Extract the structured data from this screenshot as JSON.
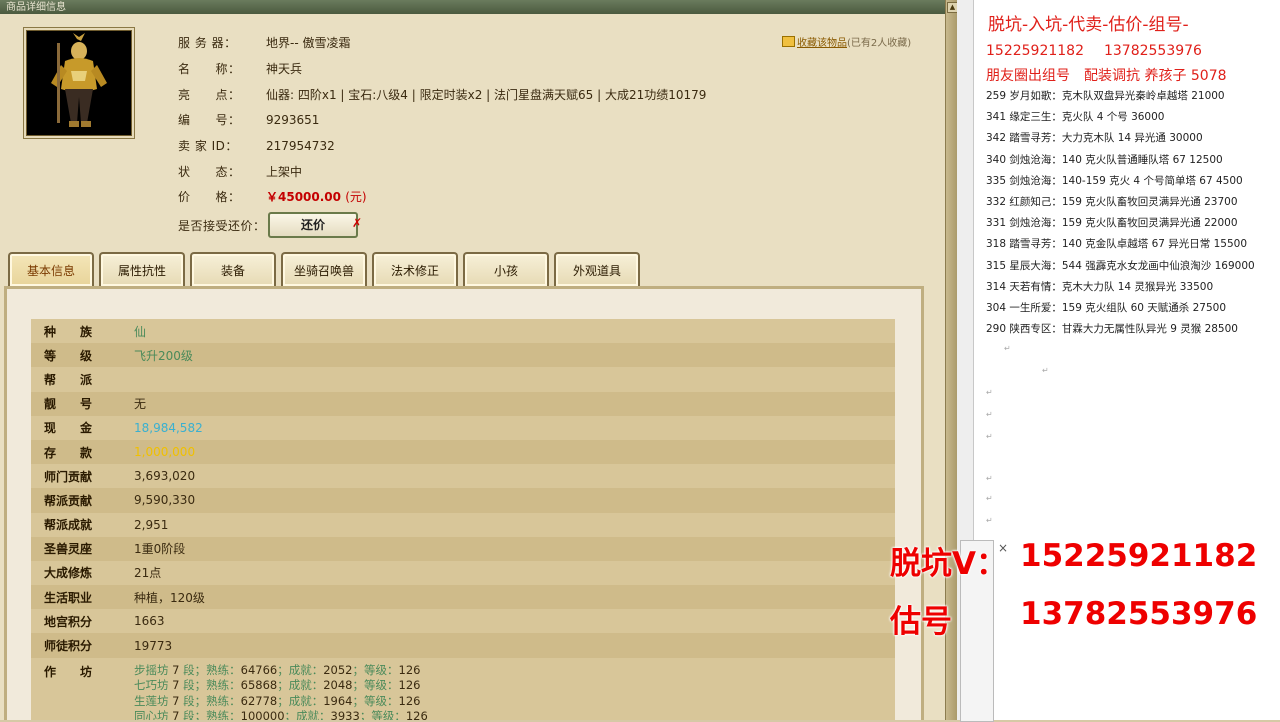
{
  "window": {
    "title": "商品详细信息"
  },
  "item": {
    "rows": [
      {
        "label": "服 务 器：",
        "value": "地界-- 傲雪凌霜"
      },
      {
        "label": "名　　称：",
        "value": "神天兵"
      },
      {
        "label": "亮　　点：",
        "value": "仙器: 四阶x1 | 宝石:八级4 | 限定时装x2 | 法门星盘满天赋65 | 大成21功绩10179"
      },
      {
        "label": "编　　号：",
        "value": "9293651"
      },
      {
        "label": "卖 家 ID：",
        "value": "217954732"
      },
      {
        "label": "状　　态：",
        "value": "上架中"
      }
    ],
    "price_label": "价　　格：",
    "price_value": "￥45000.00",
    "price_unit": "(元)",
    "bargain_label": "是否接受还价：",
    "bargain_button": "还价",
    "bargain_x": "✗"
  },
  "favorite": {
    "link": "收藏该物品",
    "count": "(已有2人收藏)"
  },
  "tabs": [
    "基本信息",
    "属性抗性",
    "装备",
    "坐骑召唤兽",
    "法术修正",
    "小孩",
    "外观道具"
  ],
  "basic_info": [
    {
      "label": "种　　族",
      "value": "仙"
    },
    {
      "label": "等　　级",
      "value": "飞升200级"
    },
    {
      "label": "帮　　派",
      "value": ""
    },
    {
      "label": "靓　　号",
      "value": "无"
    },
    {
      "label": "现　　金",
      "value": "18,984,582"
    },
    {
      "label": "存　　款",
      "value": "1,000,000"
    },
    {
      "label": "师门贡献",
      "value": "3,693,020"
    },
    {
      "label": "帮派贡献",
      "value": "9,590,330"
    },
    {
      "label": "帮派成就",
      "value": "2,951"
    },
    {
      "label": "圣兽灵座",
      "value": "1重0阶段"
    },
    {
      "label": "大成修炼",
      "value": "21点"
    },
    {
      "label": "生活职业",
      "value": "种植，120级"
    },
    {
      "label": "地宫积分",
      "value": "1663"
    },
    {
      "label": "师徒积分",
      "value": "19773"
    }
  ],
  "workshop": {
    "label": "作　　坊",
    "lines": [
      {
        "name": "步摇坊",
        "seg": "7",
        "skill": "64766",
        "achv": "2052",
        "level": "126"
      },
      {
        "name": "七巧坊",
        "seg": "7",
        "skill": "65868",
        "achv": "2048",
        "level": "126"
      },
      {
        "name": "生莲坊",
        "seg": "7",
        "skill": "62778",
        "achv": "1964",
        "level": "126"
      },
      {
        "name": "同心坊",
        "seg": "7",
        "skill": "100000",
        "achv": "3933",
        "level": "126"
      }
    ],
    "seg_word": "段；",
    "skill_word": "熟练：",
    "achv_word": "；成就：",
    "level_word": "；等级："
  },
  "ad": {
    "title": "脱坑-入坑-代卖-估价-组号-",
    "phone1": "15225921182",
    "phone2": "13782553976",
    "slogan": "朋友圈出组号　配装调抗  养孩子 5078",
    "listings": [
      "259 岁月如歌：克木队双盘异光秦岭卓越塔 21000",
      "341 缘定三生：克火队 4 个号 36000",
      "342 踏雪寻芳：大力克木队 14 异光通 30000",
      "340 剑烛沧海：140 克火队普通睡队塔 67  12500",
      "335 剑烛沧海：140-159 克火 4 个号简单塔 67  4500",
      "332 红颜知己：159 克火队畜牧回灵满异光通 23700",
      "331 剑烛沧海：159 克火队畜牧回灵满异光通 22000",
      "318 踏雪寻芳：140 克金队卓越塔 67 异光日常 15500",
      "315 星辰大海：544 强霹克水女龙画中仙浪淘沙 169000",
      "314 天若有情：克木大力队 14 灵猴异光 33500",
      "304 一生所爱：159 克火组队 60 天赋通杀 27500",
      "290 陕西专区：甘霖大力无属性队异光 9 灵猴 28500"
    ]
  },
  "overlay": {
    "line1_label": "脱坑V：",
    "line1_value": "15225921182",
    "line2_label": "估号",
    "line2_value": "13782553976",
    "close": "×"
  },
  "colors": {
    "price": "#c40000",
    "ad_red": "#e0201a",
    "cash": "#3ab0d0",
    "deposit": "#f0c000",
    "race": "#4a8a5a"
  }
}
